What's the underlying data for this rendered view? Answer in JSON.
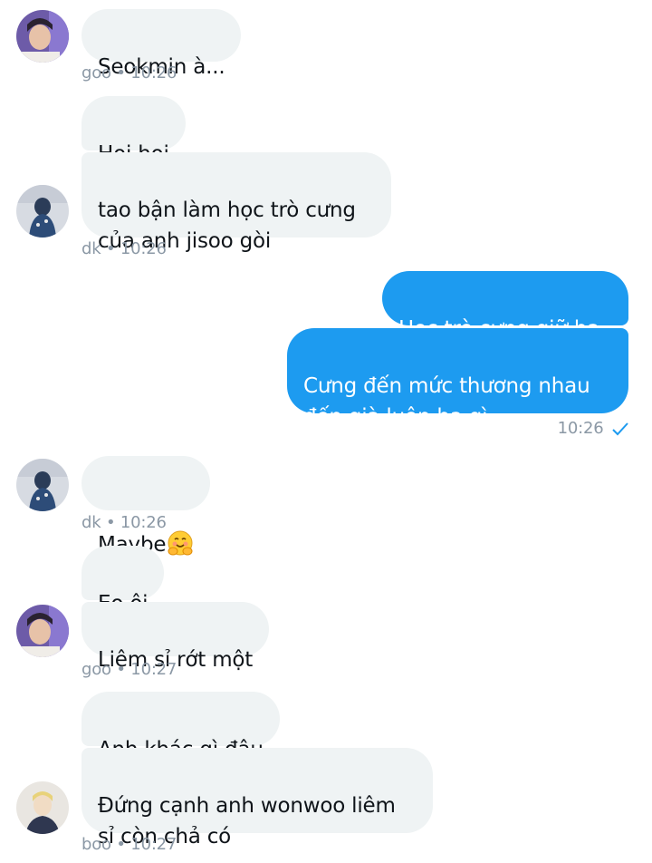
{
  "messages": [
    {
      "sender": "goo",
      "text": "Seokmin à..."
    },
    {
      "sender": "dk",
      "text": "Hoi hoi"
    },
    {
      "sender": "dk",
      "text": "tao bận làm học trò cưng\ncủa anh jisoo gòi"
    },
    {
      "sender": "me",
      "text": "Học trò cưng giữ ha"
    },
    {
      "sender": "me",
      "text": "Cưng đến mức thương nhau\nđến già luôn ha gì"
    },
    {
      "sender": "dk",
      "text": "Maybe",
      "emoji": "hugging-face-emoji"
    },
    {
      "sender": "goo",
      "text": "Eo ôi"
    },
    {
      "sender": "goo",
      "text": "Liêm sỉ rớt một"
    },
    {
      "sender": "boo",
      "text": "Anh khác gì đâu"
    },
    {
      "sender": "boo",
      "text": "Đứng cạnh anh wonwoo liêm\nsỉ còn chả có"
    }
  ],
  "meta": {
    "goo_1": "goo • 10:26",
    "dk_1": "dk • 10:26",
    "sent_1": "10:26",
    "dk_2": "dk • 10:26",
    "goo_2": "goo • 10:27",
    "boo_1": "boo • 10:27"
  },
  "icons": {
    "read_receipt": "checkmark-icon",
    "avatars": [
      "goo-avatar",
      "dk-avatar",
      "boo-avatar"
    ]
  },
  "colors": {
    "sent_bubble": "#1d9bf0",
    "received_bubble": "#eff3f4",
    "meta_text": "#8b98a5"
  }
}
